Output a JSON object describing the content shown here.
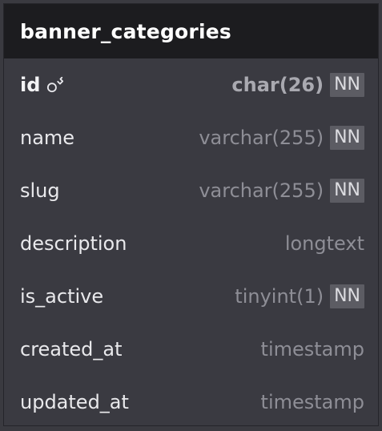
{
  "table": {
    "name": "banner_categories",
    "columns": [
      {
        "name": "id",
        "type": "char(26)",
        "not_null": "NN",
        "primary_key": true
      },
      {
        "name": "name",
        "type": "varchar(255)",
        "not_null": "NN"
      },
      {
        "name": "slug",
        "type": "varchar(255)",
        "not_null": "NN"
      },
      {
        "name": "description",
        "type": "longtext",
        "not_null": null
      },
      {
        "name": "is_active",
        "type": "tinyint(1)",
        "not_null": "NN"
      },
      {
        "name": "created_at",
        "type": "timestamp",
        "not_null": null
      },
      {
        "name": "updated_at",
        "type": "timestamp",
        "not_null": null
      }
    ]
  },
  "icons": {
    "primary_key": "key-icon"
  },
  "colors": {
    "header_bg": "#1c1c1f",
    "body_bg": "#3a3a41",
    "badge_bg": "#5c5c63"
  }
}
